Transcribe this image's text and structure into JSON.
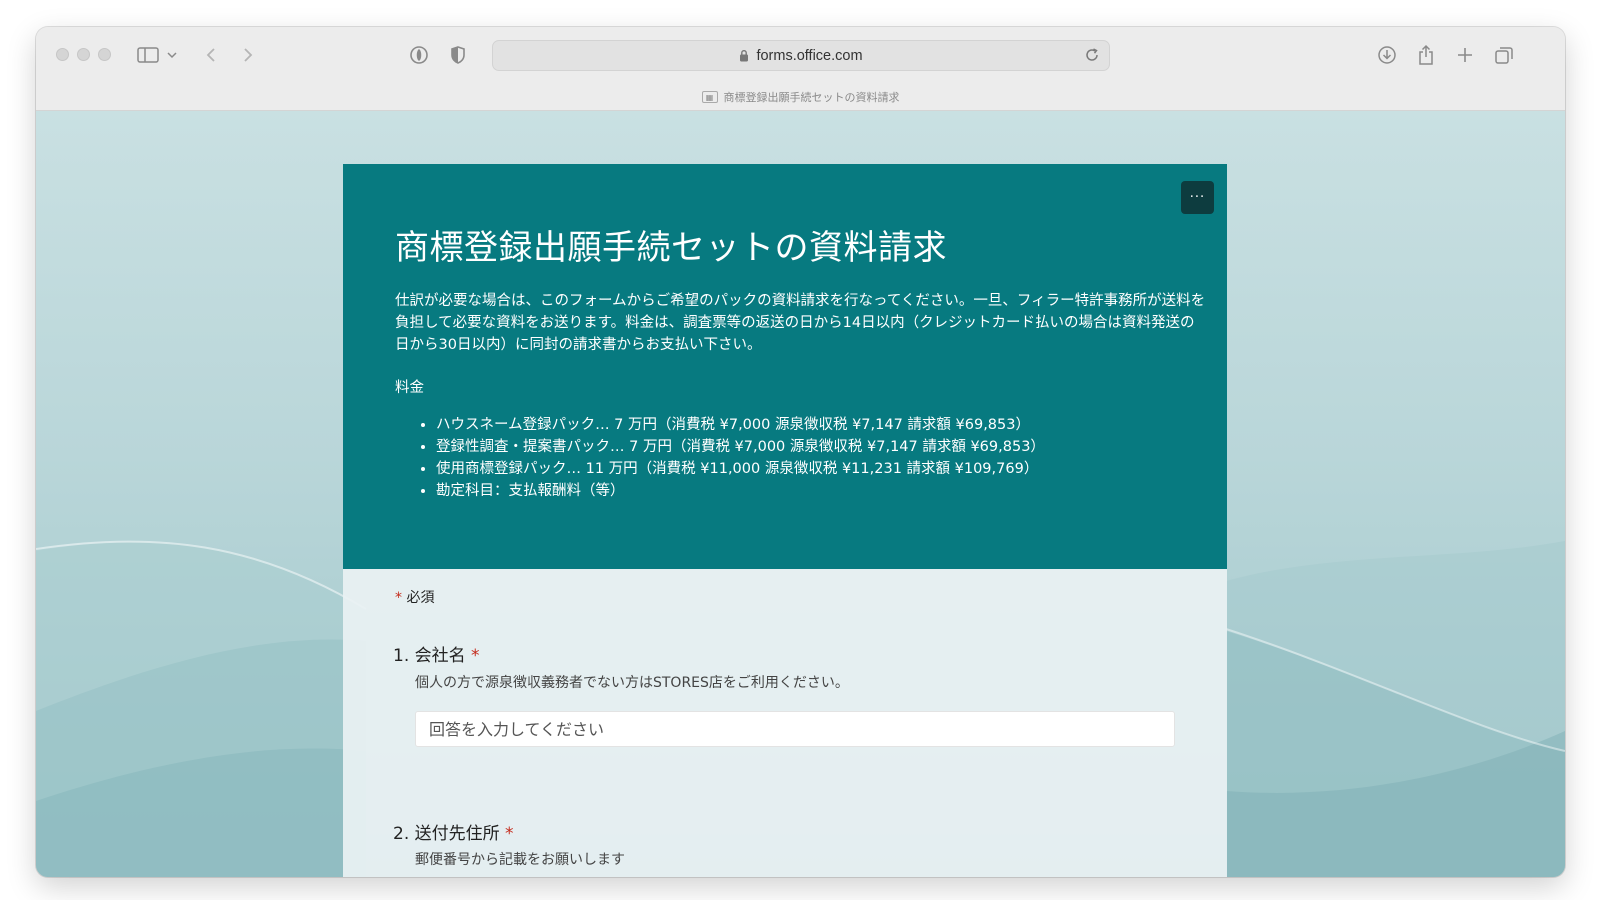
{
  "browser": {
    "url": "forms.office.com",
    "tab_title": "商標登録出願手続セットの資料請求",
    "tab_favicon": "forms-icon"
  },
  "form": {
    "title": "商標登録出願手続セットの資料請求",
    "description": "仕訳が必要な場合は、このフォームからご希望のパックの資料請求を行なってください。一旦、フィラー特許事務所が送料を負担して必要な資料をお送ります。料金は、調査票等の返送の日から14日以内（クレジットカード払いの場合は資料発送の日から30日以内）に同封の請求書からお支払い下さい。",
    "fee_heading": "料金",
    "fee_items": [
      "ハウスネーム登録パック… 7 万円（消費税 ¥7,000 源泉徴収税 ¥7,147 請求額 ¥69,853）",
      "登録性調査・提案書パック… 7 万円（消費税 ¥7,000 源泉徴収税 ¥7,147 請求額 ¥69,853）",
      "使用商標登録パック… 11 万円（消費税 ¥11,000 源泉徴収税 ¥11,231 請求額 ¥109,769）",
      "勘定科目：支払報酬料（等）"
    ],
    "more_label": "···",
    "required_star": "*",
    "required_label": "必須",
    "questions": [
      {
        "number": "1.",
        "label": "会社名",
        "star": "*",
        "subtitle": "個人の方で源泉徴収義務者でない方はSTORES店をご利用ください。",
        "placeholder": "回答を入力してください"
      },
      {
        "number": "2.",
        "label": "送付先住所",
        "star": "*",
        "subtitle": "郵便番号から記載をお願いします"
      }
    ]
  },
  "colors": {
    "header_teal": "#077a80",
    "required_red": "#c42b1c",
    "background": "#b9d6d9"
  }
}
